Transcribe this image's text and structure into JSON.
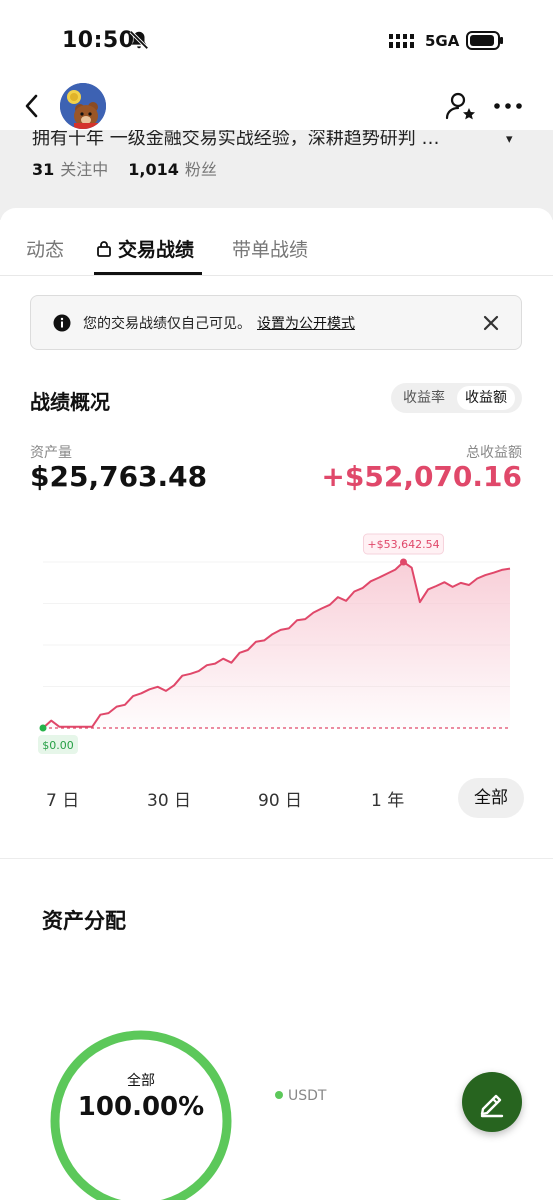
{
  "status_bar": {
    "time": "10:50",
    "network": "5GA"
  },
  "profile": {
    "bio_snippet": "拥有十年 一级金融交易实战经验，深耕趋势研判 …",
    "following_count": "31",
    "following_label": "关注中",
    "followers_count": "1,014",
    "followers_label": "粉丝"
  },
  "tabs": [
    {
      "label": "动态"
    },
    {
      "label": "交易战绩",
      "active": true,
      "icon": "lock-icon"
    },
    {
      "label": "带单战绩"
    }
  ],
  "notice": {
    "text": "您的交易战绩仅自己可见。",
    "link": "设置为公开模式"
  },
  "performance": {
    "title": "战绩概况",
    "toggle_options": [
      "收益率",
      "收益额"
    ],
    "toggle_selected": "收益额",
    "asset_label": "资产量",
    "asset_value": "$25,763.48",
    "profit_label": "总收益额",
    "profit_value": "+$52,070.16"
  },
  "chart_data": {
    "type": "area",
    "x_range": [
      "start",
      "end"
    ],
    "y_min_label": "$0.00",
    "y_max_label": "+$53,642.54",
    "values": [
      0,
      2400,
      400,
      400,
      400,
      400,
      400,
      4300,
      4800,
      6900,
      7500,
      10300,
      11200,
      12500,
      13300,
      12000,
      13800,
      16900,
      17500,
      18400,
      20300,
      20800,
      22400,
      21100,
      24300,
      25200,
      27900,
      28300,
      30300,
      31700,
      32200,
      34800,
      35200,
      37300,
      38600,
      39800,
      42300,
      41100,
      44100,
      45200,
      47400,
      48600,
      49900,
      51200,
      53642,
      51800,
      40700,
      44800,
      45900,
      47100,
      45600,
      46900,
      46200,
      48300,
      49400,
      50200,
      51100,
      51500
    ],
    "baseline": 0,
    "colors": {
      "line": "#e0486a",
      "fill_top": "#f7c6d1",
      "baseline": "#e0486a",
      "start_dot": "#27b34a"
    }
  },
  "time_ranges": [
    {
      "label": "7 日"
    },
    {
      "label": "30 日"
    },
    {
      "label": "90 日"
    },
    {
      "label": "1 年"
    },
    {
      "label": "全部",
      "active": true
    }
  ],
  "allocation": {
    "title": "资产分配",
    "center_label": "全部",
    "center_value": "100.00%",
    "legend": [
      {
        "name": "USDT",
        "color": "#5cc85a"
      }
    ]
  },
  "colors": {
    "accent_red": "#e0486a",
    "fab_green": "#27641f",
    "donut_green": "#5cc85a"
  }
}
